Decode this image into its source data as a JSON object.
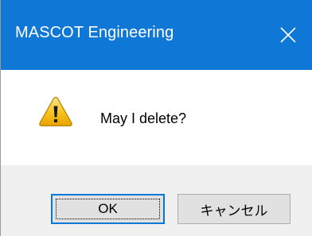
{
  "window": {
    "title": "MASCOT Engineering",
    "accent_color": "#0f78d7",
    "close_icon": "close-icon"
  },
  "message": {
    "icon": "warning-icon",
    "text": "May I delete?"
  },
  "buttons": {
    "ok_label": "OK",
    "cancel_label": "キャンセル",
    "default": "ok"
  }
}
